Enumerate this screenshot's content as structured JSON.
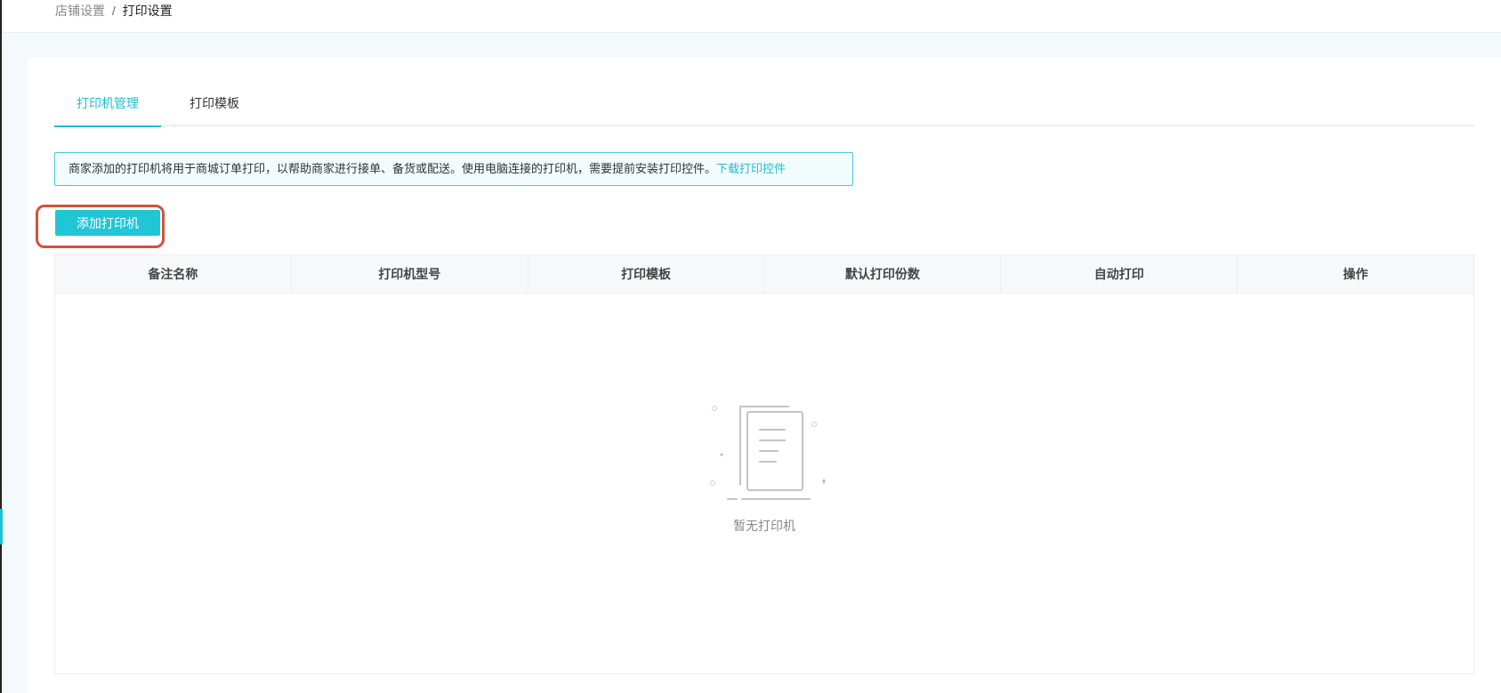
{
  "breadcrumb": {
    "parent": "店铺设置",
    "separator": "/",
    "current": "打印设置"
  },
  "tabs": [
    {
      "label": "打印机管理",
      "active": true
    },
    {
      "label": "打印模板",
      "active": false
    }
  ],
  "notice": {
    "text": "商家添加的打印机将用于商城订单打印，以帮助商家进行接单、备货或配送。使用电脑连接的打印机，需要提前安装打印控件。",
    "link": "下载打印控件"
  },
  "add_button": {
    "label": "添加打印机"
  },
  "table": {
    "columns": [
      "备注名称",
      "打印机型号",
      "打印模板",
      "默认打印份数",
      "自动打印",
      "操作"
    ],
    "rows": [],
    "empty_text": "暂无打印机"
  },
  "colors": {
    "accent": "#1fc6d6",
    "highlight": "#d0533a"
  },
  "icons": {
    "empty": "empty-documents-icon"
  }
}
